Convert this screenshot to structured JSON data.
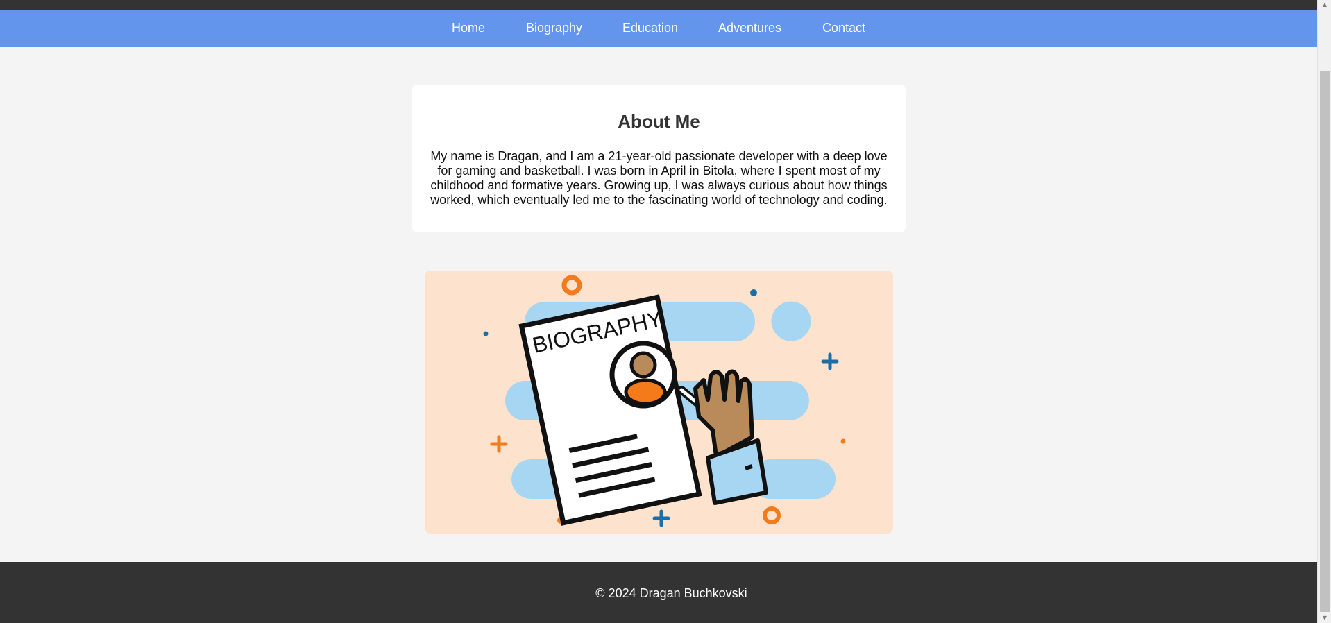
{
  "nav": {
    "items": [
      {
        "label": "Home"
      },
      {
        "label": "Biography"
      },
      {
        "label": "Education"
      },
      {
        "label": "Adventures"
      },
      {
        "label": "Contact"
      }
    ]
  },
  "about": {
    "title": "About Me",
    "text": "My name is Dragan, and I am a 21-year-old passionate developer with a deep love for gaming and basketball. I was born in April in Bitola, where I spent most of my childhood and formative years. Growing up, I was always curious about how things worked, which eventually led me to the fascinating world of technology and coding."
  },
  "illustration": {
    "document_heading": "BIOGRAPHY"
  },
  "footer": {
    "copyright": "© 2024 Dragan Buchkovski"
  },
  "colors": {
    "nav_background": "#6495ed",
    "top_bar": "#333333",
    "page_background": "#f4f4f4",
    "footer_background": "#333333",
    "illustration_background": "#fde3ce",
    "accent_orange": "#f47a1a",
    "accent_blue": "#1a6fa8",
    "light_blue": "#a6d6f2"
  },
  "icons": {
    "scroll_up": "scroll-up-arrow-icon",
    "scroll_down": "scroll-down-arrow-icon"
  }
}
